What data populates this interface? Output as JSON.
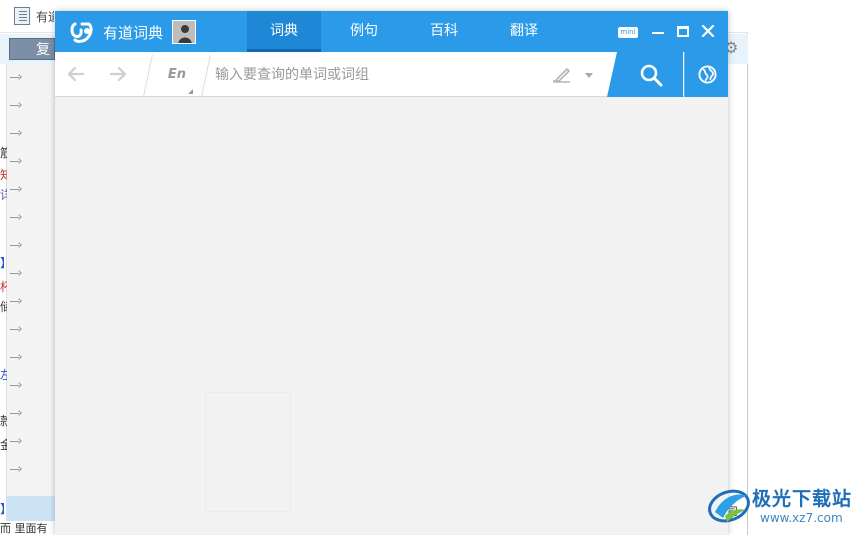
{
  "background_window": {
    "title_text": "有道",
    "copy_button_label": "复",
    "left_fragments": [
      "筋",
      "知",
      "详",
      "】",
      "杯",
      "储",
      "左",
      "款",
      "金",
      "】"
    ],
    "bottom_text": "而 里面有",
    "right_fragment": "司"
  },
  "youdao": {
    "app_title": "有道词典",
    "tabs": [
      {
        "label": "词典",
        "active": true
      },
      {
        "label": "例句",
        "active": false
      },
      {
        "label": "百科",
        "active": false
      },
      {
        "label": "翻译",
        "active": false
      }
    ],
    "window_controls": {
      "mini_label": "mini"
    },
    "search": {
      "language_label": "En",
      "placeholder": "输入要查询的单词或词组",
      "value": ""
    },
    "colors": {
      "brand_blue": "#2b9ae8",
      "content_background": "#f2f2f2"
    }
  },
  "watermark": {
    "title": "极光下载站",
    "url": "www.xz7.com"
  }
}
